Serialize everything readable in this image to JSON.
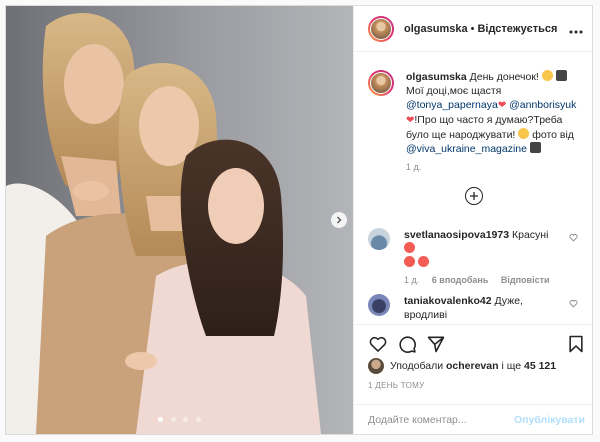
{
  "post": {
    "author": "olgasumska",
    "separator": "•",
    "follow_state": "Відстежується",
    "caption": {
      "username": "olgasumska",
      "text1": "День донечок!",
      "text2": "Мої доці,моє щастя",
      "mention1": "@tonya_papernaya",
      "mention2": "@annborisyuk",
      "text3": "!Про що часто я думаю?Треба було ще народжувати!",
      "text4": "фото від",
      "mention3": "@viva_ukraine_magazine",
      "time": "1 д."
    },
    "comments": [
      {
        "username": "svetlanaosipova1973",
        "text": "Красуні",
        "time": "1 д.",
        "likes": "6 вподобань",
        "reply": "Відповісти"
      },
      {
        "username": "taniakovalenko42",
        "text": "Дуже, вродливі"
      }
    ],
    "likes": {
      "prefix": "Уподобали",
      "user": "ocherevan",
      "connector": "і ще",
      "count": "45 121"
    },
    "timestamp": "1 ДЕНЬ ТОМУ",
    "comment_placeholder": "Додайте коментар...",
    "publish_label": "Опублікувати"
  },
  "icons": {
    "more": "more-icon",
    "like": "heart-icon",
    "comment": "comment-icon",
    "share": "share-icon",
    "save": "bookmark-icon",
    "add": "plus-circle-icon",
    "next": "chevron-right-icon"
  },
  "colors": {
    "like_heart": "#ed4956",
    "mention": "#00376b",
    "publish_disabled": "#b2dffc",
    "muted": "#8e8e8e"
  }
}
